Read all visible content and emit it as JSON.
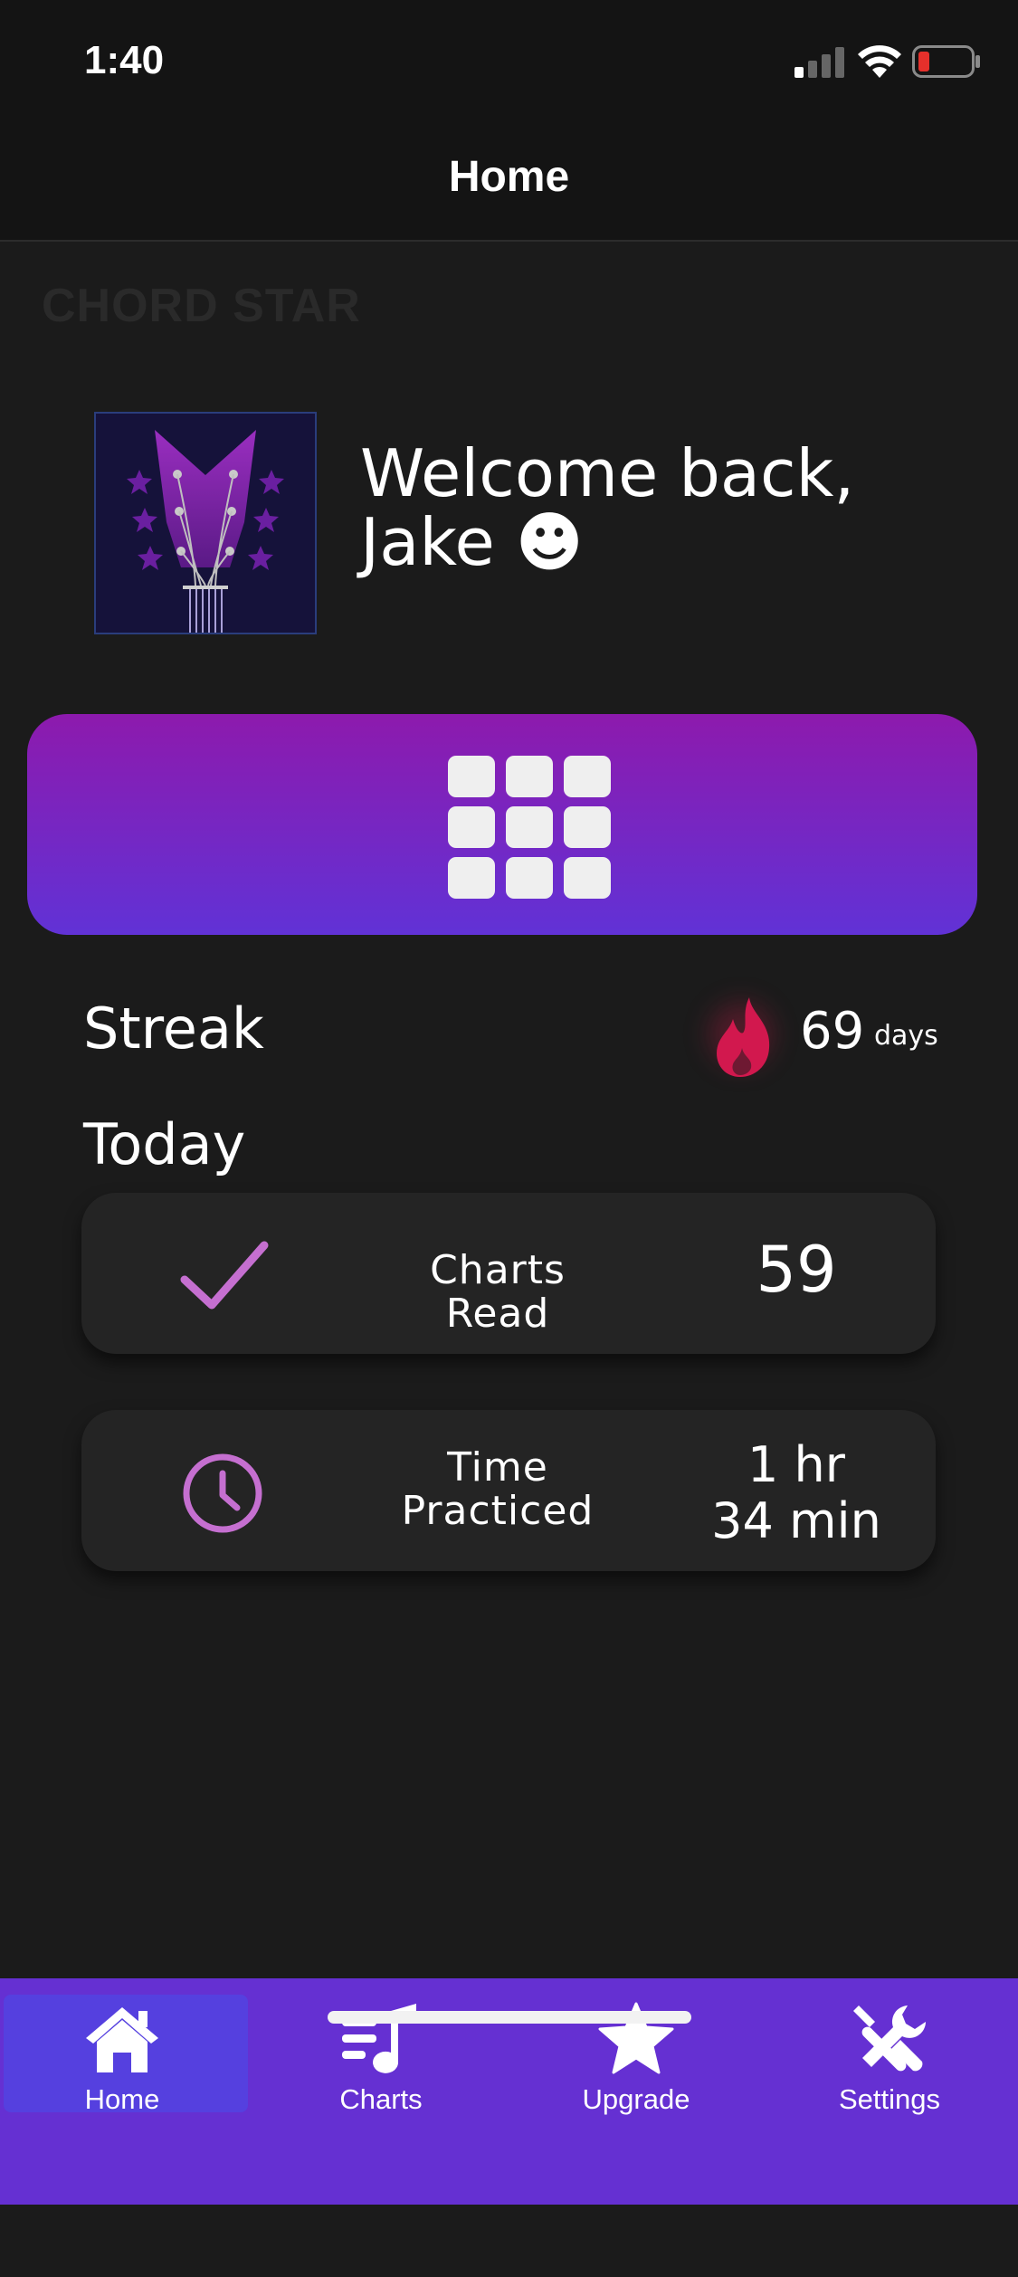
{
  "status_bar": {
    "time": "1:40"
  },
  "navbar": {
    "title": "Home"
  },
  "brand": {
    "watermark": "CHORD STAR"
  },
  "welcome": {
    "line1": "Welcome back,",
    "line2": "Jake ☻"
  },
  "streak": {
    "label": "Streak",
    "value": "69",
    "unit": "days"
  },
  "today": {
    "label": "Today",
    "cards": [
      {
        "label": "Charts Read",
        "value": "59",
        "icon": "check-icon"
      },
      {
        "label_line1": "Time",
        "label_line2": "Practiced",
        "value_line1": "1 hr",
        "value_line2": "34 min",
        "icon": "clock-icon"
      }
    ]
  },
  "tabs": [
    {
      "label": "Home",
      "icon": "home-icon",
      "active": true
    },
    {
      "label": "Charts",
      "icon": "music-list-icon",
      "active": false
    },
    {
      "label": "Upgrade",
      "icon": "star-icon",
      "active": false
    },
    {
      "label": "Settings",
      "icon": "tools-icon",
      "active": false
    }
  ],
  "colors": {
    "accent": "#6530d2",
    "gradient_top": "#8d1aad",
    "gradient_bottom": "#6132d6",
    "icon_accent": "#c56fd0",
    "flame": "#d2184e"
  }
}
